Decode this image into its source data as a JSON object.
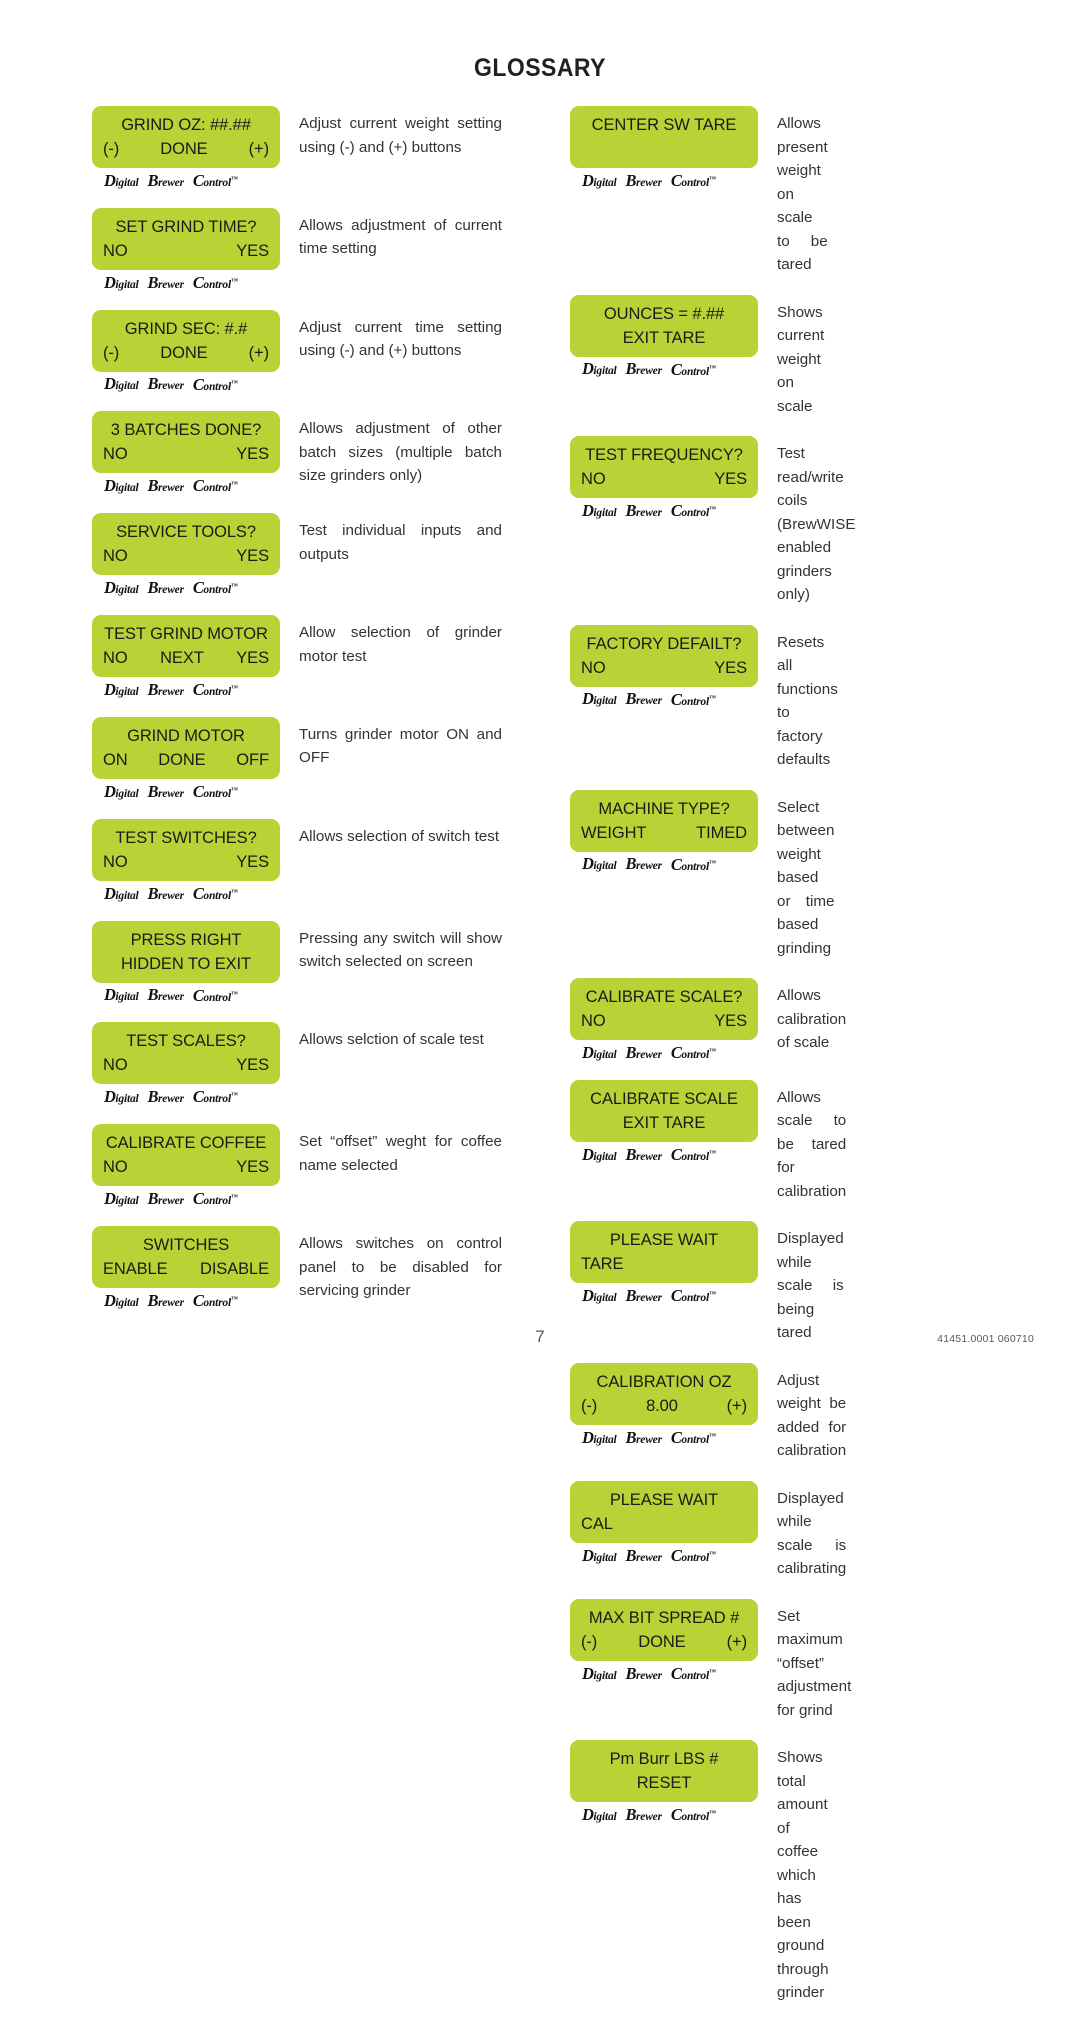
{
  "page": {
    "title": "GLOSSARY",
    "page_number": "7",
    "doc_code": "41451.0001  060710",
    "lcd_color": "#b7d335",
    "logo": {
      "word1_cap": "D",
      "word1_rest": "igital",
      "word2_cap": "B",
      "word2_rest": "rewer",
      "word3_cap": "C",
      "word3_rest": "ontrol",
      "tm": "™"
    }
  },
  "left_column": [
    {
      "line1": "GRIND OZ: ##.##",
      "line2_segments": [
        "(-)",
        "DONE",
        "(+)"
      ],
      "line1_align": "center",
      "line2_align": "spread",
      "description": "Adjust current weight setting using (-) and (+) buttons"
    },
    {
      "line1": "SET GRIND TIME?",
      "line2_segments": [
        "NO",
        "YES"
      ],
      "line1_align": "center",
      "line2_align": "spread",
      "description": "Allows adjustment of current time setting"
    },
    {
      "line1": "GRIND SEC: #.#",
      "line2_segments": [
        "(-)",
        "DONE",
        "(+)"
      ],
      "line1_align": "center",
      "line2_align": "spread",
      "description": "Adjust current time setting using (-) and (+) buttons"
    },
    {
      "line1": "3 BATCHES DONE?",
      "line2_segments": [
        "NO",
        "YES"
      ],
      "line1_align": "center",
      "line2_align": "spread",
      "description": "Allows adjustment of other batch sizes (multiple batch size grinders only)"
    },
    {
      "line1": "SERVICE TOOLS?",
      "line2_segments": [
        "NO",
        "YES"
      ],
      "line1_align": "center",
      "line2_align": "spread",
      "description": "Test individual inputs and outputs"
    },
    {
      "line1": "TEST GRIND MOTOR",
      "line2_segments": [
        "NO",
        "NEXT",
        "YES"
      ],
      "line1_align": "center",
      "line2_align": "spread",
      "description": "Allow selection of grinder motor test"
    },
    {
      "line1": "GRIND MOTOR",
      "line2_segments": [
        "ON",
        "DONE",
        "OFF"
      ],
      "line1_align": "center",
      "line2_align": "spread",
      "description": "Turns grinder motor ON and OFF"
    },
    {
      "line1": "TEST SWITCHES?",
      "line2_segments": [
        "NO",
        "YES"
      ],
      "line1_align": "center",
      "line2_align": "spread",
      "description": "Allows selection of switch test"
    },
    {
      "line1": "PRESS RIGHT",
      "line2_segments": [
        "HIDDEN TO EXIT"
      ],
      "line1_align": "center",
      "line2_align": "center",
      "description": "Pressing any switch will show switch selected on screen"
    },
    {
      "line1": "TEST SCALES?",
      "line2_segments": [
        "NO",
        "YES"
      ],
      "line1_align": "center",
      "line2_align": "spread",
      "description": "Allows selction of scale test"
    },
    {
      "line1": "CALIBRATE COFFEE",
      "line2_segments": [
        "NO",
        "YES"
      ],
      "line1_align": "center",
      "line2_align": "spread",
      "description": "Set “offset” weght for coffee name selected"
    },
    {
      "line1": "SWITCHES",
      "line2_segments": [
        "ENABLE",
        "DISABLE"
      ],
      "line1_align": "center",
      "line2_align": "spread",
      "description": "Allows switches on control panel to be disabled for servicing grinder"
    }
  ],
  "right_column": [
    {
      "line1": "CENTER SW TARE",
      "line2_segments": [],
      "line1_align": "center",
      "line2_align": "empty",
      "description": "Allows present weight on scale to be tared"
    },
    {
      "line1": "OUNCES = #.##",
      "line2_segments": [
        "EXIT TARE"
      ],
      "line1_align": "center",
      "line2_align": "center",
      "description": "Shows current weight on scale"
    },
    {
      "line1": "TEST FREQUENCY?",
      "line2_segments": [
        "NO",
        "YES"
      ],
      "line1_align": "center",
      "line2_align": "spread",
      "description": "Test read/write coils (BrewWISE enabled grinders only)"
    },
    {
      "line1": "FACTORY DEFAILT?",
      "line2_segments": [
        "NO",
        "YES"
      ],
      "line1_align": "center",
      "line2_align": "spread",
      "description": "Resets all functions to factory defaults"
    },
    {
      "line1": "MACHINE TYPE?",
      "line2_segments": [
        "WEIGHT",
        "TIMED"
      ],
      "line1_align": "center",
      "line2_align": "spread",
      "description": "Select between weight based or time based grinding"
    },
    {
      "line1": "CALIBRATE SCALE?",
      "line2_segments": [
        "NO",
        "YES"
      ],
      "line1_align": "center",
      "line2_align": "spread",
      "description": "Allows calibration of scale"
    },
    {
      "line1": "CALIBRATE SCALE",
      "line2_segments": [
        "EXIT TARE"
      ],
      "line1_align": "center",
      "line2_align": "center",
      "description": "Allows scale to be tared for calibration"
    },
    {
      "line1": "PLEASE WAIT",
      "line2_segments": [
        "TARE"
      ],
      "line1_align": "center",
      "line2_align": "left",
      "description": "Displayed while scale is being tared"
    },
    {
      "line1": "CALIBRATION OZ",
      "line2_segments": [
        "(-)",
        "8.00",
        "(+)"
      ],
      "line1_align": "center",
      "line2_align": "spread",
      "description": "Adjust weight be added for calibration"
    },
    {
      "line1": "PLEASE WAIT",
      "line2_segments": [
        "CAL"
      ],
      "line1_align": "center",
      "line2_align": "left",
      "description": "Displayed while scale is calibrating"
    },
    {
      "line1": "MAX BIT SPREAD #",
      "line2_segments": [
        "(-)",
        "DONE",
        "(+)"
      ],
      "line1_align": "center",
      "line2_align": "spread",
      "description": "Set maximum “offset” adjustment for grind"
    },
    {
      "line1": "Pm Burr LBS     #",
      "line2_segments": [
        "RESET"
      ],
      "line1_align": "center",
      "line2_align": "center",
      "description": "Shows total amount of coffee which has been ground through grinder"
    }
  ]
}
